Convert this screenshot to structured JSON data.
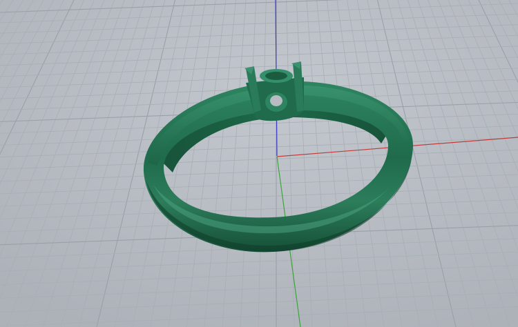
{
  "viewport": {
    "view": "perspective",
    "background_color": "#b9bdc4",
    "grid": {
      "visible": true,
      "minor_line_color": "#a9aeb5",
      "major_line_color": "#9ba0a8"
    },
    "axes": {
      "x_color": "#c23b3b",
      "y_color": "#3aa53a",
      "z_color": "#3b3bc8"
    },
    "model": {
      "object": "ring-with-solitaire-head",
      "color": "#1f6b4c",
      "highlight_color": "#3c9170",
      "shadow_color": "#0f3d2a"
    }
  }
}
